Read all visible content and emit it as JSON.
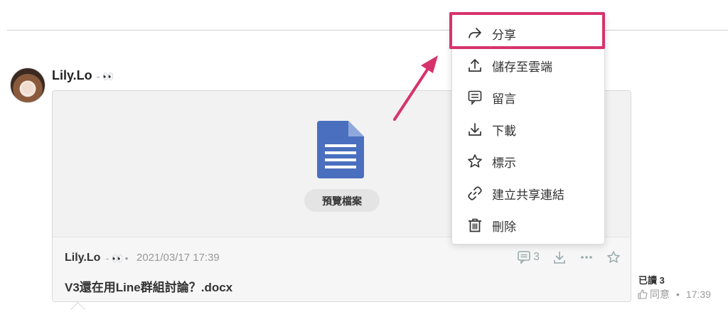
{
  "post": {
    "author": "Lily.Lo",
    "author_sep": "-",
    "author_emoji": "👀"
  },
  "card": {
    "preview_label": "預覽檔案",
    "message_author": "Lily.Lo",
    "message_sep": "-",
    "message_emoji": "👀",
    "message_dot": "•",
    "message_time": "2021/03/17 17:39",
    "file_name": "V3還在用Line群組討論？.docx",
    "comment_count": "3"
  },
  "status": {
    "read_label": "已讀 3",
    "agree_label": "同意",
    "dot": "•",
    "time": "17:39"
  },
  "menu": {
    "items": [
      {
        "label": "分享",
        "icon": "share-icon"
      },
      {
        "label": "儲存至雲端",
        "icon": "upload-icon"
      },
      {
        "label": "留言",
        "icon": "comment-icon"
      },
      {
        "label": "下載",
        "icon": "download-icon"
      },
      {
        "label": "標示",
        "icon": "star-icon"
      },
      {
        "label": "建立共享連結",
        "icon": "link-icon"
      },
      {
        "label": "刪除",
        "icon": "trash-icon"
      }
    ]
  },
  "colors": {
    "annotation": "#d6336c",
    "doc_icon": "#4a6fbf"
  }
}
